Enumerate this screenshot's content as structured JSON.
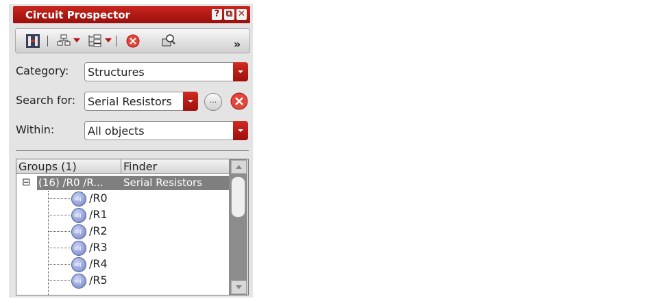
{
  "window": {
    "title": "Circuit Prospector",
    "help_label": "?",
    "float_label": "⧉",
    "close_label": "✕"
  },
  "toolbar": {
    "overflow_label": "»"
  },
  "category": {
    "label": "Category:",
    "value": "Structures"
  },
  "search_for": {
    "label": "Search for:",
    "value": "Serial Resistors",
    "more_label": "..."
  },
  "within": {
    "label": "Within:",
    "value": "All objects"
  },
  "tree": {
    "columns": [
      "Groups (1)",
      "Finder"
    ],
    "group": {
      "expander": "⊟",
      "name": "(16) /R0 /R...",
      "finder": "Serial Resistors"
    },
    "items": [
      "/R0",
      "/R1",
      "/R2",
      "/R3",
      "/R4",
      "/R5"
    ],
    "obj_badge": "obj"
  }
}
